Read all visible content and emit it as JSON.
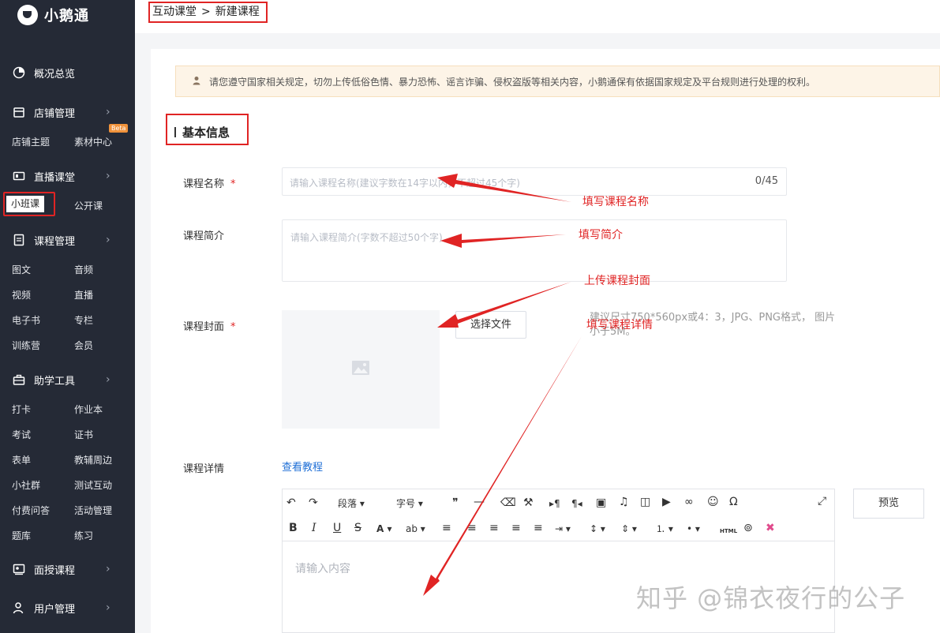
{
  "sidebar": {
    "logo": "小鹅通",
    "groups": [
      {
        "label": "概况总览",
        "icon": "pie-chart-icon"
      },
      {
        "label": "店铺管理",
        "icon": "store-icon"
      },
      {
        "label": "直播课堂",
        "icon": "video-icon"
      },
      {
        "label": "课程管理",
        "icon": "document-icon"
      },
      {
        "label": "助学工具",
        "icon": "toolbox-icon"
      },
      {
        "label": "面授课程",
        "icon": "classroom-icon"
      },
      {
        "label": "用户管理",
        "icon": "user-icon"
      }
    ],
    "store_items": [
      "店铺主题",
      "素材中心"
    ],
    "beta": "Beta",
    "live_items": [
      "小班课",
      "公开课"
    ],
    "course_items": [
      "图文",
      "音频",
      "视频",
      "直播",
      "电子书",
      "专栏",
      "训练营",
      "会员"
    ],
    "tool_items": [
      "打卡",
      "作业本",
      "考试",
      "证书",
      "表单",
      "教辅周边",
      "小社群",
      "测试互动",
      "付费问答",
      "活动管理",
      "题库",
      "练习"
    ]
  },
  "breadcrumb": {
    "parent": "互动课堂",
    "sep": ">",
    "current": "新建课程"
  },
  "notice": "请您遵守国家相关规定，切勿上传低俗色情、暴力恐怖、谣言诈骗、侵权盗版等相关内容，小鹅通保有依据国家规定及平台规则进行处理的权利。",
  "section_title": "基本信息",
  "form": {
    "name_label": "课程名称",
    "name_placeholder": "请输入课程名称(建议字数在14字以内，不超过45个字)",
    "name_counter": "0/45",
    "intro_label": "课程简介",
    "intro_placeholder": "请输入课程简介(字数不超过50个字)",
    "cover_label": "课程封面",
    "select_file": "选择文件",
    "cover_hint": "建议尺寸750*560px或4：3，JPG、PNG格式， 图片小于5M。",
    "detail_label": "课程详情",
    "tutorial_link": "查看教程",
    "required_mark": "*"
  },
  "editor": {
    "paragraph": "段落",
    "font_size": "字号",
    "placeholder": "请输入内容",
    "preview": "预览",
    "html": "HTML"
  },
  "annotations": [
    "填写课程名称",
    "填写简介",
    "上传课程封面",
    "填写课程详情"
  ],
  "watermark": "知乎 @锦衣夜行的公子",
  "colors": {
    "sidebar": "#252a36",
    "annotation": "#e02424",
    "link": "#1f6fd6"
  }
}
